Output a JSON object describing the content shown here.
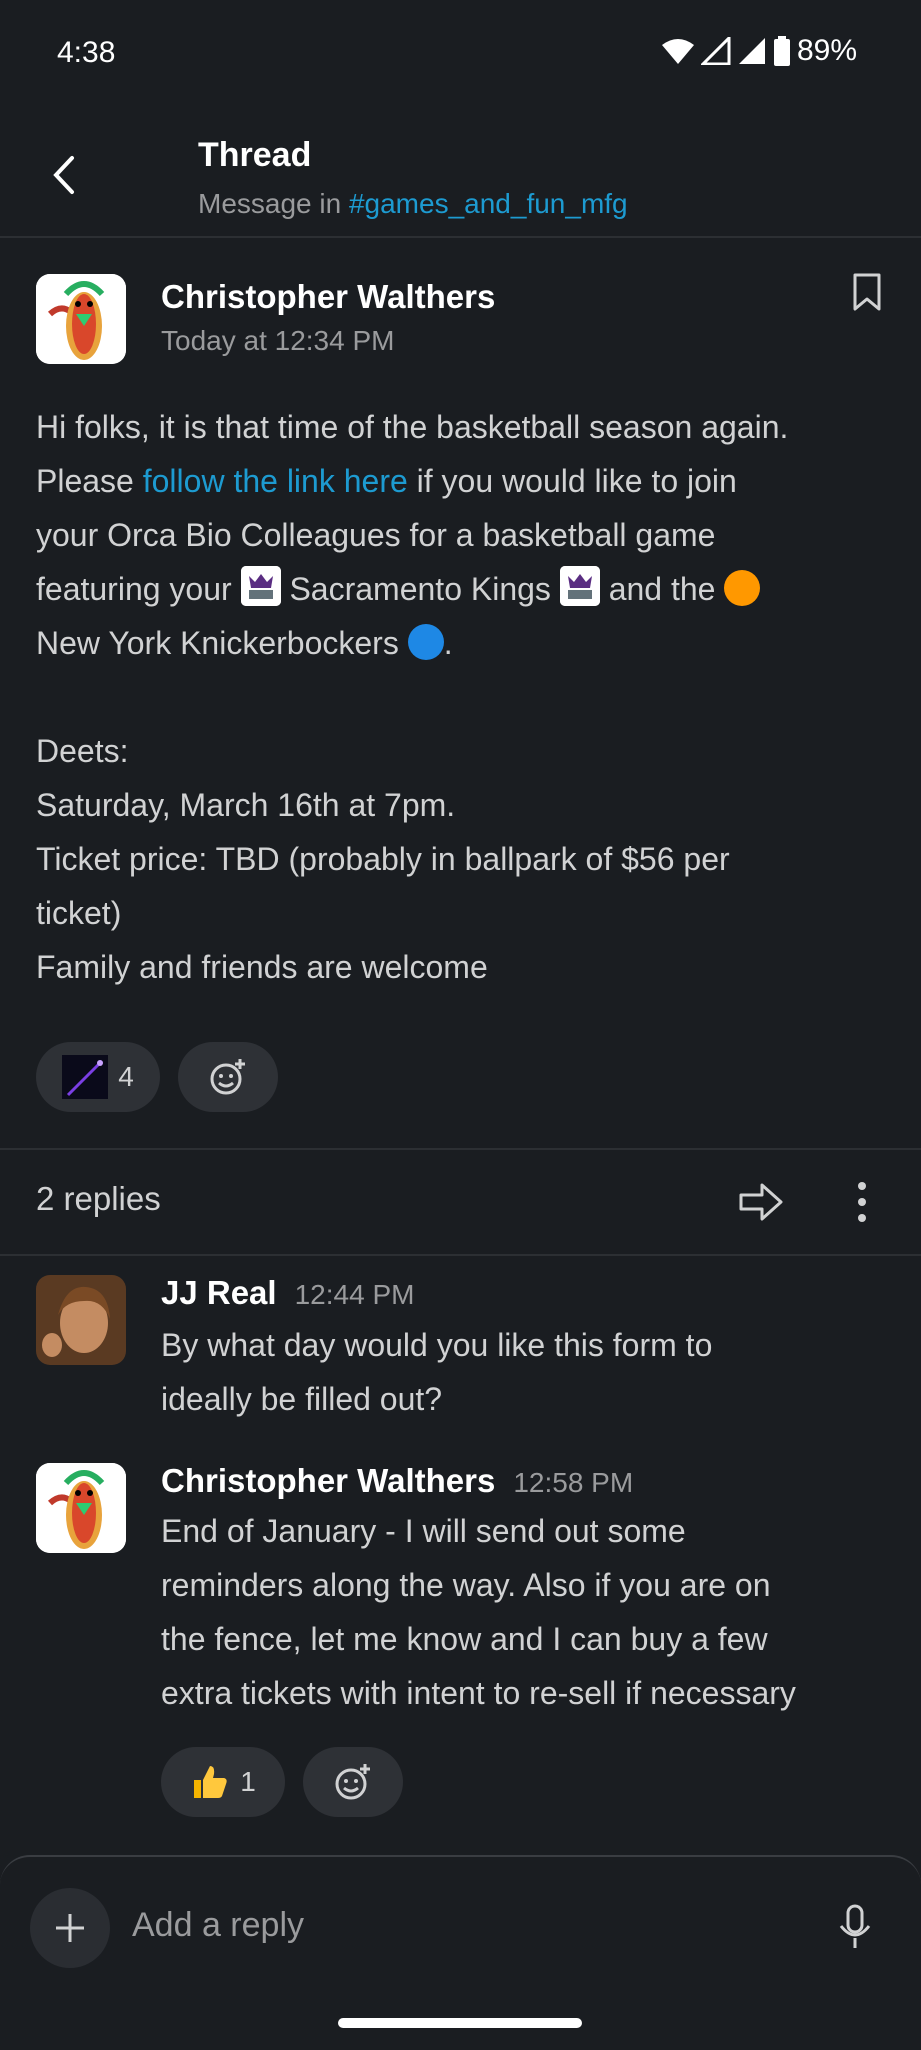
{
  "status_bar": {
    "time": "4:38",
    "battery": "89%"
  },
  "header": {
    "title": "Thread",
    "subtitle_prefix": "Message in ",
    "channel": "#games_and_fun_mfg"
  },
  "parent_message": {
    "author": "Christopher Walthers",
    "timestamp": "Today at 12:34 PM",
    "line1": "Hi folks, it is that time of the basketball season again.",
    "line2_before": "Please ",
    "line2_link": "follow the link here",
    "line2_after": " if you would like to join",
    "line3": "your Orca Bio Colleagues for a basketball game",
    "line4_a": "featuring your ",
    "line4_b": " Sacramento Kings ",
    "line4_c": " and the ",
    "line5_a": "New York Knickerbockers ",
    "line5_b": ".",
    "line6": "Deets:",
    "line7": "Saturday, March 16th at 7pm.",
    "line8": "Ticket price: TBD (probably in ballpark of $56 per",
    "line9": "ticket)",
    "line10": "Family and friends are welcome",
    "reaction_count": "4"
  },
  "replies_label": "2 replies",
  "replies": [
    {
      "author": "JJ Real",
      "time": "12:44 PM",
      "lines": [
        "By what day would you like this form to",
        "ideally be filled out?"
      ]
    },
    {
      "author": "Christopher Walthers",
      "time": "12:58 PM",
      "lines": [
        "End of January - I will send out some",
        "reminders along the way. Also if you are on",
        "the fence, let me know and I can buy a few",
        "extra tickets with intent to re-sell if necessary"
      ],
      "reaction_count": "1"
    }
  ],
  "composer": {
    "placeholder": "Add a reply"
  },
  "icons": {
    "back": "chevron-left-icon",
    "bookmark": "bookmark-icon",
    "share": "share-arrow-icon",
    "more": "more-vertical-icon",
    "add_reaction": "add-reaction-icon",
    "thumbs_up": "thumbs-up-emoji",
    "plus": "plus-icon",
    "mic": "microphone-icon"
  },
  "colors": {
    "background": "#1a1d21",
    "link": "#1d9bd1",
    "orange": "#ff9800",
    "blue": "#1e88e5"
  }
}
